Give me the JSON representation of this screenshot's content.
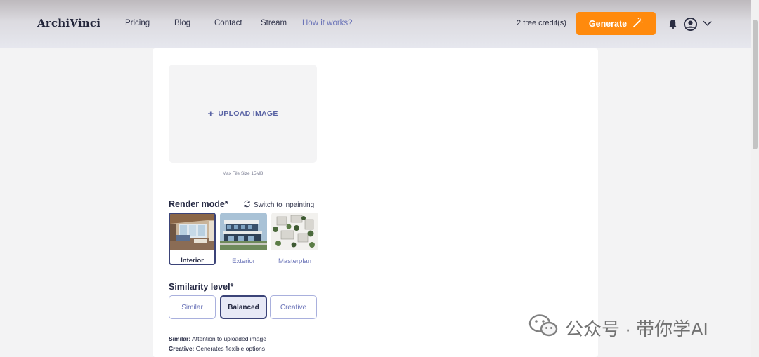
{
  "header": {
    "logo": "ArchiVinci",
    "nav": [
      "Pricing",
      "Blog",
      "Contact",
      "Stream",
      "How it works?"
    ],
    "credits": "2 free credit(s)",
    "generate_label": "Generate"
  },
  "upload": {
    "label": "UPLOAD IMAGE",
    "max_size": "Max File Size 15MB"
  },
  "render_mode": {
    "title": "Render mode*",
    "switch_label": "Switch to inpainting",
    "options": [
      "Interior",
      "Exterior",
      "Masterplan"
    ],
    "selected": "Interior"
  },
  "similarity": {
    "title": "Similarity level*",
    "options": [
      "Similar",
      "Balanced",
      "Creative"
    ],
    "selected": "Balanced"
  },
  "legend": {
    "similar_key": "Similar:",
    "similar_text": " Attention to uploaded image",
    "creative_key": "Creative:",
    "creative_text": " Generates flexible options"
  },
  "watermark": {
    "text": "公众号 · 带你学AI"
  },
  "colors": {
    "accent": "#ff8a0d",
    "primary": "#3b4378",
    "link": "#6b74b8"
  },
  "icons": [
    "plus-icon",
    "refresh-icon",
    "magic-wand-icon",
    "bell-icon",
    "user-avatar-icon",
    "chevron-down-icon",
    "wechat-icon"
  ]
}
